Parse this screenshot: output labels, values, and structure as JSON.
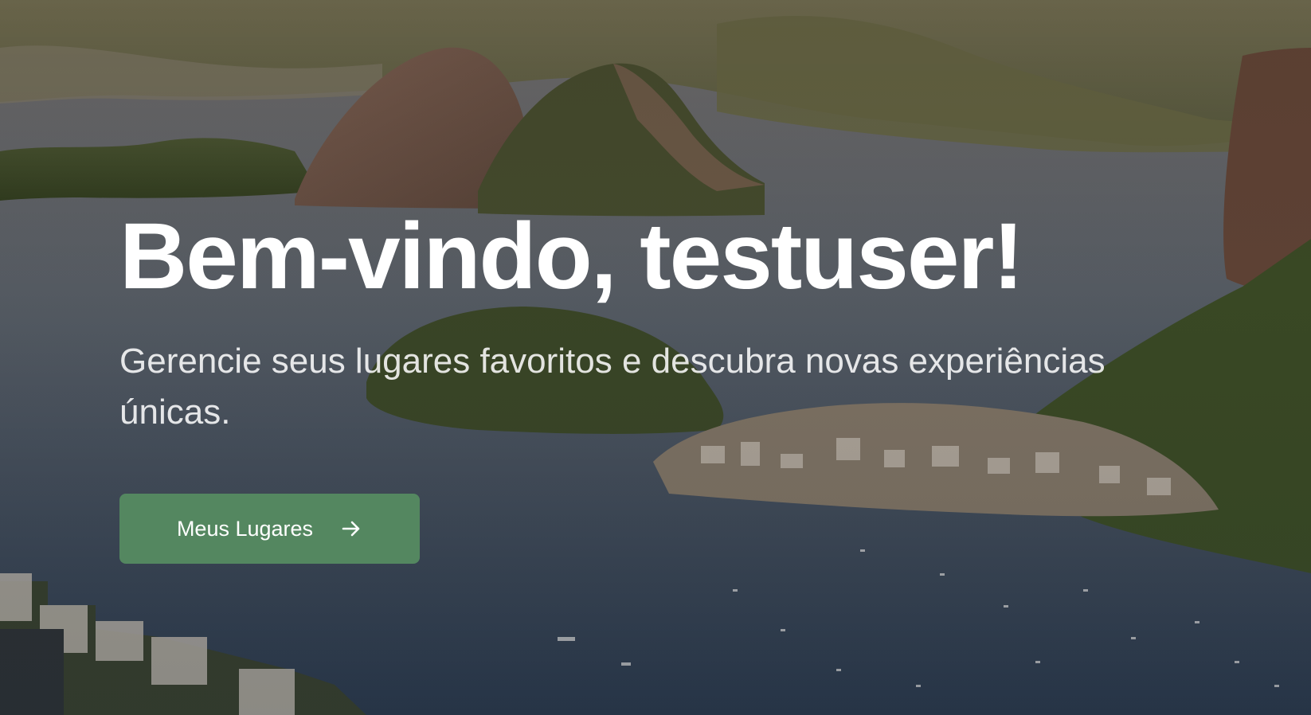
{
  "hero": {
    "title": "Bem-vindo, testuser!",
    "subtitle": "Gerencie seus lugares favoritos e descubra novas experiências únicas.",
    "cta": {
      "label": "Meus Lugares",
      "icon": "arrow-right-icon"
    },
    "background_image": "rio-de-janeiro-bay-photo"
  },
  "colors": {
    "button_bg": "#548760",
    "title_text": "#ffffff"
  }
}
